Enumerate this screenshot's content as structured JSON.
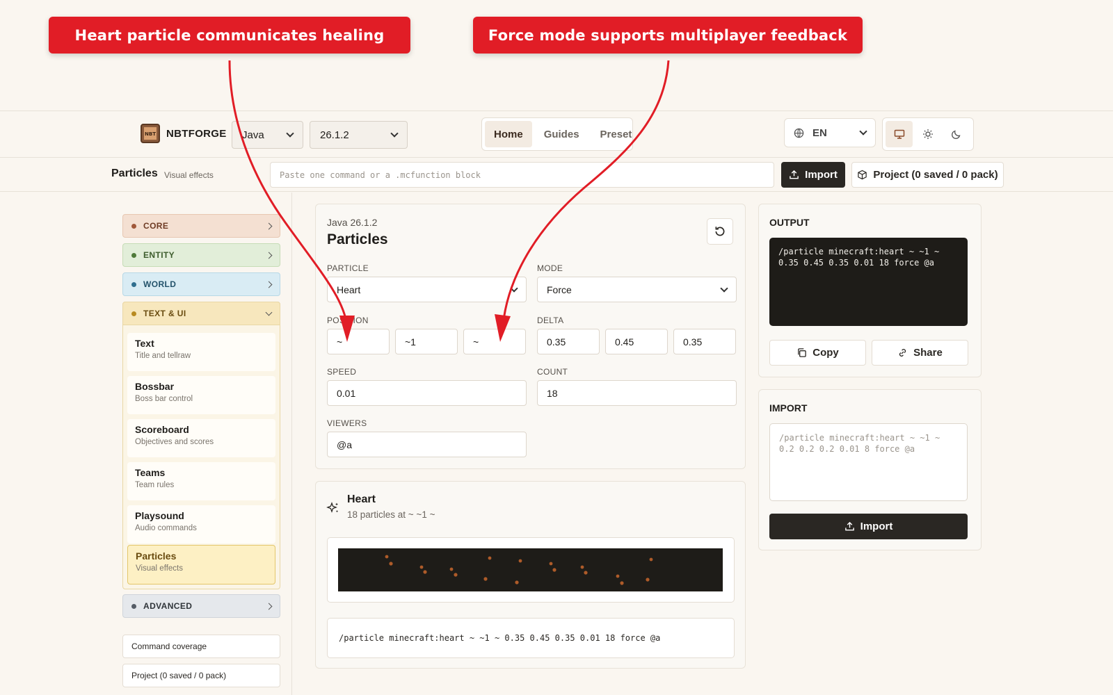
{
  "annotations": {
    "callout_1": "Heart particle communicates healing",
    "callout_2": "Force mode supports multiplayer feedback"
  },
  "header": {
    "logo_text": "NBT",
    "brand": "NBTFORGE",
    "edition": "Java",
    "version": "26.1.2",
    "nav": [
      "Home",
      "Guides",
      "Preset"
    ],
    "language": "EN",
    "theme_icons": [
      "monitor-icon",
      "sun-icon",
      "moon-icon"
    ]
  },
  "subheader": {
    "title": "Particles",
    "subtitle": "Visual effects",
    "paste_placeholder": "Paste one command or a .mcfunction block",
    "import_label": "Import",
    "project_label": "Project (0 saved / 0 pack)"
  },
  "sidebar": {
    "categories": [
      {
        "label": "CORE",
        "color": "#f4e0d2",
        "dot": "#a0583a"
      },
      {
        "label": "ENTITY",
        "color": "#e2eed9",
        "dot": "#4f7a3a"
      },
      {
        "label": "WORLD",
        "color": "#d9ecf4",
        "dot": "#2f6f8f"
      },
      {
        "label": "TEXT & UI",
        "color": "#f7e7bd",
        "dot": "#b88a20"
      },
      {
        "label": "ADVANCED",
        "color": "#e5e8ec",
        "dot": "#555c66"
      }
    ],
    "items": [
      {
        "title": "Text",
        "sub": "Title and tellraw"
      },
      {
        "title": "Bossbar",
        "sub": "Boss bar control"
      },
      {
        "title": "Scoreboard",
        "sub": "Objectives and scores"
      },
      {
        "title": "Teams",
        "sub": "Team rules"
      },
      {
        "title": "Playsound",
        "sub": "Audio commands"
      },
      {
        "title": "Particles",
        "sub": "Visual effects"
      }
    ],
    "links": [
      "Command coverage",
      "Project (0 saved / 0 pack)"
    ]
  },
  "form": {
    "context": "Java 26.1.2",
    "title": "Particles",
    "particle_label": "PARTICLE",
    "particle_value": "Heart",
    "mode_label": "MODE",
    "mode_value": "Force",
    "position_label": "POSITION",
    "position": [
      "~",
      "~1",
      "~"
    ],
    "delta_label": "DELTA",
    "delta": [
      "0.35",
      "0.45",
      "0.35"
    ],
    "speed_label": "SPEED",
    "speed": "0.01",
    "count_label": "COUNT",
    "count": "18",
    "viewers_label": "VIEWERS",
    "viewers": "@a"
  },
  "preview": {
    "title": "Heart",
    "subtitle": "18 particles at ~ ~1 ~",
    "command": "/particle minecraft:heart ~ ~1 ~ 0.35 0.45 0.35 0.01 18 force @a"
  },
  "output": {
    "label": "OUTPUT",
    "text": "/particle minecraft:heart ~ ~1 ~ 0.35 0.45 0.35 0.01 18 force @a",
    "copy_label": "Copy",
    "share_label": "Share"
  },
  "import": {
    "label": "IMPORT",
    "placeholder": "/particle minecraft:heart ~ ~1 ~ 0.2 0.2 0.2 0.01 8 force @a",
    "button_label": "Import"
  },
  "colors": {
    "accent_red": "#e11d26",
    "dark": "#2a2723",
    "particle": "#c8672c"
  }
}
